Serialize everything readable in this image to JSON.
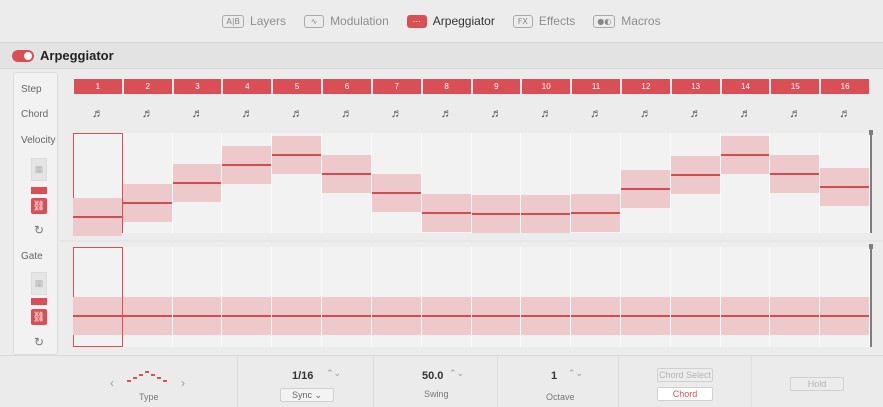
{
  "nav": {
    "tabs": [
      {
        "icon": "A|B",
        "label": "Layers",
        "active": false
      },
      {
        "icon": "∿",
        "label": "Modulation",
        "active": false
      },
      {
        "icon": "⋯",
        "label": "Arpeggiator",
        "active": true
      },
      {
        "icon": "FX",
        "label": "Effects",
        "active": false
      },
      {
        "icon": "●◐",
        "label": "Macros",
        "active": false
      }
    ]
  },
  "header": {
    "title": "Arpeggiator",
    "enabled": true
  },
  "rows": {
    "step": "Step",
    "chord": "Chord",
    "velocity": "Velocity",
    "gate": "Gate"
  },
  "steps": [
    "1",
    "2",
    "3",
    "4",
    "5",
    "6",
    "7",
    "8",
    "9",
    "10",
    "11",
    "12",
    "13",
    "14",
    "15",
    "16"
  ],
  "chord_glyph": "♬",
  "accent_color": "#d94f55",
  "selected_step": 1,
  "velocity_values": [
    0.16,
    0.3,
    0.5,
    0.68,
    0.78,
    0.59,
    0.4,
    0.2,
    0.19,
    0.19,
    0.2,
    0.44,
    0.58,
    0.78,
    0.59,
    0.46
  ],
  "gate_values": [
    0.31,
    0.31,
    0.31,
    0.31,
    0.31,
    0.31,
    0.31,
    0.31,
    0.31,
    0.31,
    0.31,
    0.31,
    0.31,
    0.31,
    0.31,
    0.31
  ],
  "bottom": {
    "type_label": "Type",
    "rate_value": "1/16",
    "sync_label": "Sync",
    "swing_value": "50.0",
    "swing_label": "Swing",
    "octave_value": "1",
    "octave_label": "Octave",
    "chord_select_label": "Chord Select",
    "chord_label": "Chord",
    "hold_label": "Hold"
  }
}
